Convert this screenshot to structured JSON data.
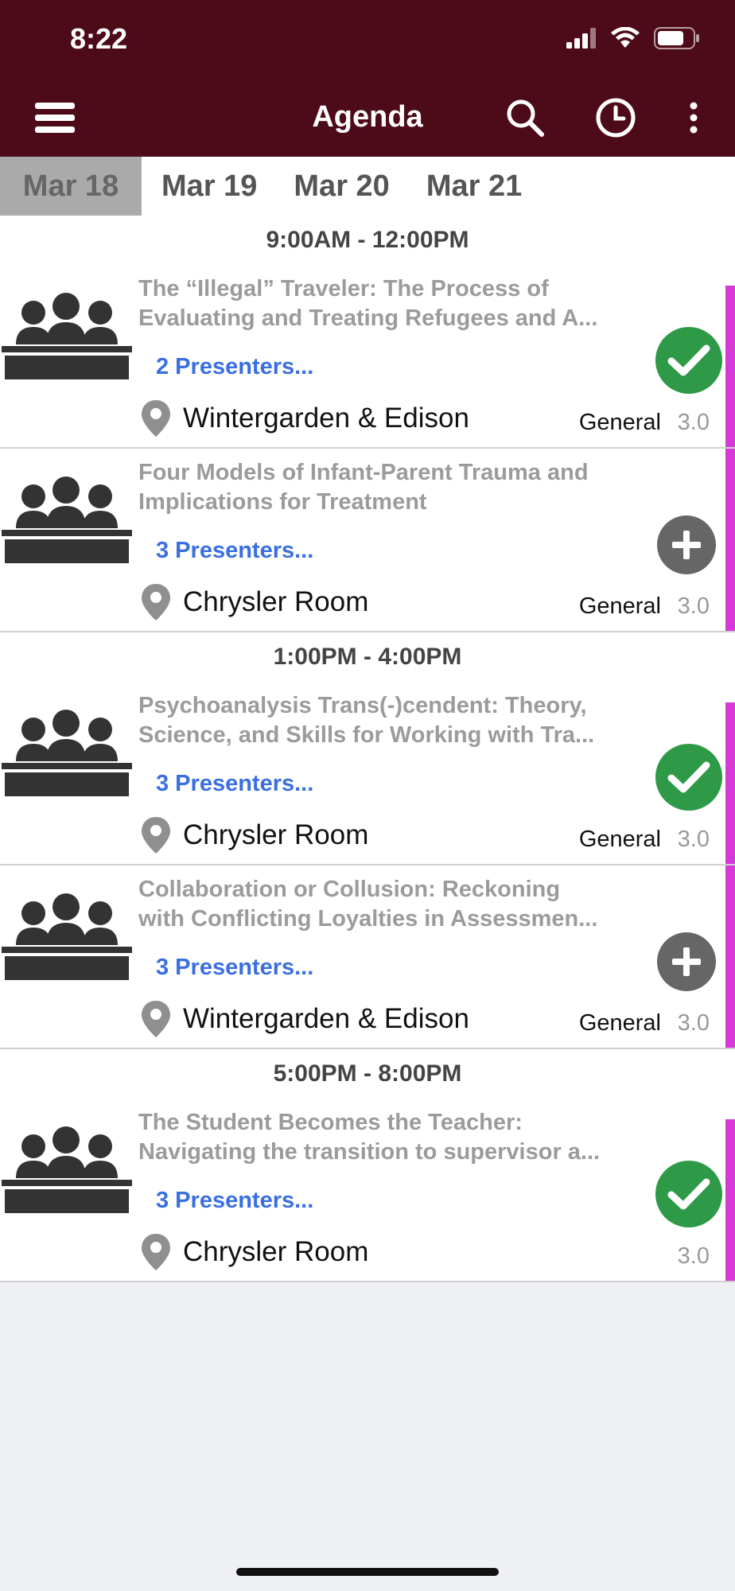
{
  "status_bar": {
    "time": "8:22"
  },
  "appbar": {
    "title": "Agenda",
    "menu_icon": "hamburger-icon",
    "search_icon": "search-icon",
    "history_icon": "clock-icon",
    "more_icon": "more-vertical-icon"
  },
  "tabs": [
    {
      "label": "Mar 18",
      "active": true
    },
    {
      "label": "Mar 19",
      "active": false
    },
    {
      "label": "Mar 20",
      "active": false
    },
    {
      "label": "Mar 21",
      "active": false
    }
  ],
  "slots": [
    {
      "time": "9:00AM - 12:00PM",
      "sessions": [
        {
          "title_line1": "The “Illegal” Traveler: The Process of",
          "title_line2": "Evaluating and Treating Refugees and A...",
          "presenters": "2 Presenters...",
          "location": "Wintergarden & Edison",
          "type": "General",
          "credits": "3.0",
          "status": "added"
        },
        {
          "title_line1": "Four Models of Infant-Parent Trauma and",
          "title_line2": "Implications for Treatment",
          "presenters": "3 Presenters...",
          "location": "Chrysler Room",
          "type": "General",
          "credits": "3.0",
          "status": "add"
        }
      ]
    },
    {
      "time": "1:00PM - 4:00PM",
      "sessions": [
        {
          "title_line1": "Psychoanalysis Trans(-)cendent: Theory,",
          "title_line2": "Science, and Skills for Working with Tra...",
          "presenters": "3 Presenters...",
          "location": "Chrysler Room",
          "type": "General",
          "credits": "3.0",
          "status": "added"
        },
        {
          "title_line1": "Collaboration or Collusion: Reckoning",
          "title_line2": "with Conflicting Loyalties in Assessmen...",
          "presenters": "3 Presenters...",
          "location": "Wintergarden & Edison",
          "type": "General",
          "credits": "3.0",
          "status": "add"
        }
      ]
    },
    {
      "time": "5:00PM - 8:00PM",
      "sessions": [
        {
          "title_line1": "The Student Becomes the Teacher:",
          "title_line2": "Navigating the transition to supervisor a...",
          "presenters": "3 Presenters...",
          "location": "Chrysler Room",
          "type": "",
          "credits": "3.0",
          "status": "added"
        }
      ]
    }
  ],
  "colors": {
    "brand": "#4d0a18",
    "added": "#2e9a48",
    "add": "#666666",
    "accent": "#d63ad6",
    "link": "#3a6fe0"
  }
}
